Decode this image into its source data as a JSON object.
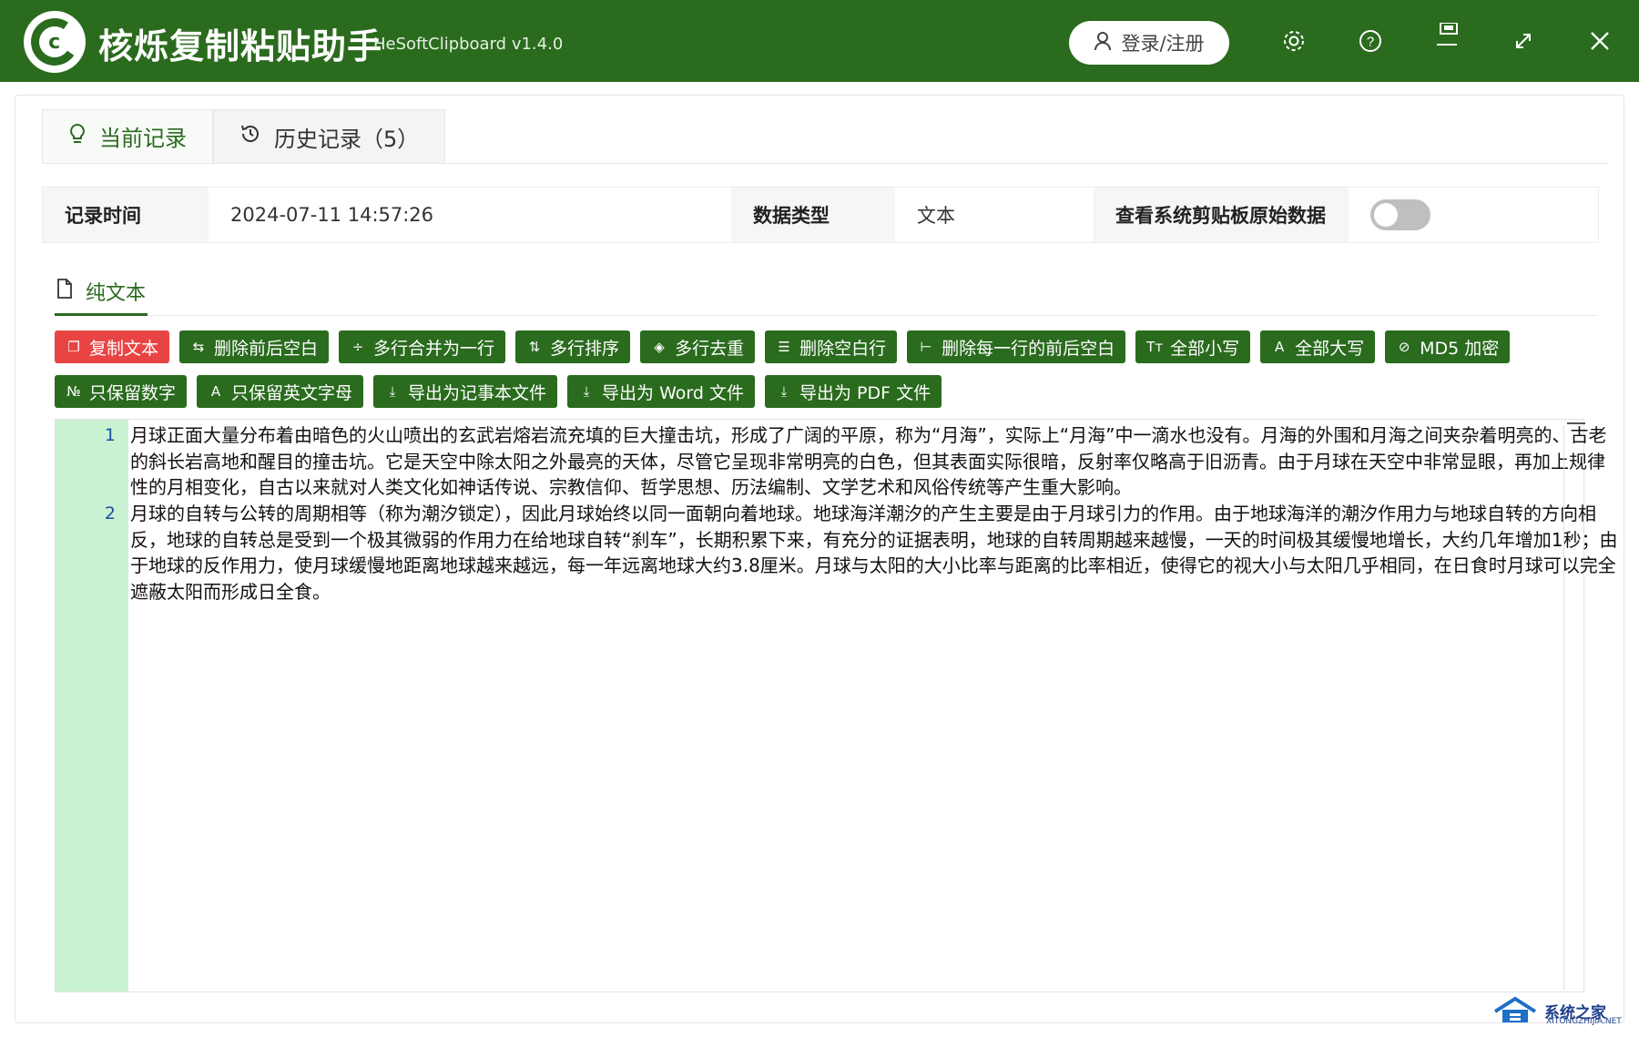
{
  "app": {
    "title": "核烁复制粘贴助手",
    "version": "HeSoftClipboard v1.4.0",
    "login_label": "登录/注册"
  },
  "icons": {
    "settings": "gear-icon",
    "help": "help-icon",
    "minimize": "minimize-icon",
    "maximize": "maximize-icon",
    "close": "close-icon"
  },
  "tabs": [
    {
      "label": "当前记录",
      "icon": "bulb-icon"
    },
    {
      "label": "历史记录（5）",
      "icon": "history-icon"
    }
  ],
  "info": {
    "time_label": "记录时间",
    "time_value": "2024-07-11 14:57:26",
    "type_label": "数据类型",
    "type_value": "文本",
    "raw_label": "查看系统剪贴板原始数据",
    "raw_toggle": false
  },
  "subtab": {
    "label": "纯文本"
  },
  "toolbar": {
    "row1": [
      "复制文本",
      "删除前后空白",
      "多行合并为一行",
      "多行排序",
      "多行去重",
      "删除空白行",
      "删除每一行的前后空白",
      "全部小写",
      "全部大写",
      "MD5 加密"
    ],
    "row2": [
      "只保留数字",
      "只保留英文字母",
      "导出为记事本文件",
      "导出为 Word 文件",
      "导出为 PDF 文件"
    ]
  },
  "editor": {
    "lines": [
      {
        "number": "1",
        "text": "月球正面大量分布着由暗色的火山喷出的玄武岩熔岩流充填的巨大撞击坑，形成了广阔的平原，称为“月海”，实际上“月海”中一滴水也没有。月海的外围和月海之间夹杂着明亮的、古老的斜长岩高地和醒目的撞击坑。它是天空中除太阳之外最亮的天体，尽管它呈现非常明亮的白色，但其表面实际很暗，反射率仅略高于旧沥青。由于月球在天空中非常显眼，再加上规律性的月相变化，自古以来就对人类文化如神话传说、宗教信仰、哲学思想、历法编制、文学艺术和风俗传统等产生重大影响。"
      },
      {
        "number": "2",
        "text": "月球的自转与公转的周期相等（称为潮汐锁定），因此月球始终以同一面朝向着地球。地球海洋潮汐的产生主要是由于月球引力的作用。由于地球海洋的潮汐作用力与地球自转的方向相反，地球的自转总是受到一个极其微弱的作用力在给地球自转“刹车”，长期积累下来，有充分的证据表明，地球的自转周期越来越慢，一天的时间极其缓慢地增长，大约几年增加1秒；由于地球的反作用力，使月球缓慢地距离地球越来越远，每一年远离地球大约3.8厘米。月球与太阳的大小比率与距离的比率相近，使得它的视大小与太阳几乎相同，在日食时月球可以完全遮蔽太阳而形成日全食。"
      }
    ]
  },
  "watermark": {
    "name": "系统之家",
    "url": "XITONGZHIJIA.NET"
  },
  "colors": {
    "brand": "#2a6b1e",
    "danger": "#e94444",
    "gutter": "#c9f2d3"
  }
}
